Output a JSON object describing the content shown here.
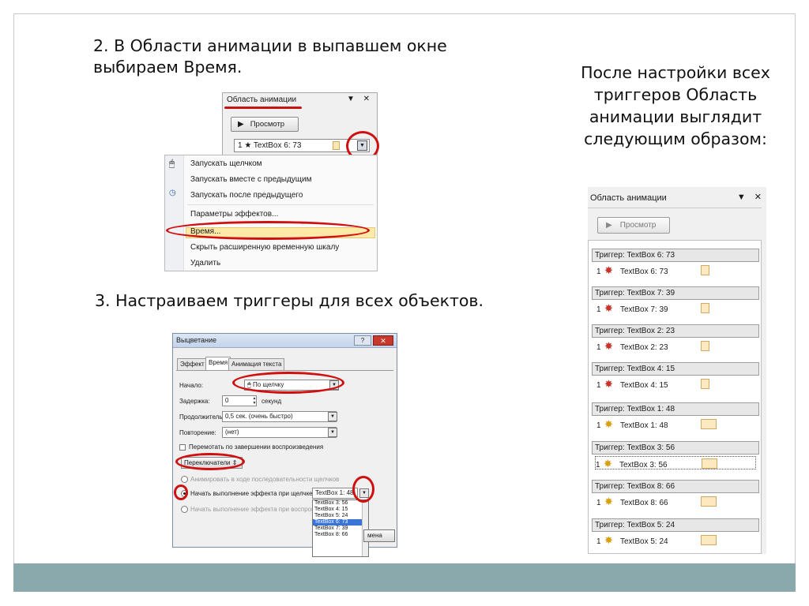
{
  "slide": {
    "step2_text": "2. В Области анимации в выпавшем окне выбираем Время.",
    "step3_text": "3. Настраиваем триггеры для всех объектов.",
    "right_text": "После настройки всех триггеров Область анимации выглядит следующим образом:"
  },
  "pane1": {
    "title": "Область анимации",
    "controls": "▼ ✕",
    "preview_label": "Просмотр",
    "row": "1 ★ TextBox 6: 73"
  },
  "context_menu": {
    "items": [
      {
        "label": "Запускать щелчком",
        "icon": "mouse-click-icon"
      },
      {
        "label": "Запускать вместе с предыдущим",
        "icon": ""
      },
      {
        "label": "Запускать после предыдущего",
        "icon": "clock-icon"
      },
      {
        "label": "Параметры эффектов...",
        "icon": ""
      },
      {
        "label": "Время...",
        "icon": ""
      },
      {
        "label": "Скрыть расширенную временную шкалу",
        "icon": ""
      },
      {
        "label": "Удалить",
        "icon": ""
      }
    ]
  },
  "dialog": {
    "title": "Выцветание",
    "help": "?",
    "close": "✕",
    "tabs": [
      "Эффект",
      "Время",
      "Анимация текста"
    ],
    "start_label": "Начало:",
    "start_value": "По щелчку",
    "delay_label": "Задержка:",
    "delay_value": "0",
    "delay_unit": "секунд",
    "duration_label": "Продолжительность:",
    "duration_value": "0,5 сек. (очень быстро)",
    "repeat_label": "Повторение:",
    "repeat_value": "(нет)",
    "rewind_label": "Перемотать по завершении воспроизведения",
    "switches_button": "Переключатели",
    "radio_animate": "Анимировать в ходе последовательности щелчков",
    "radio_start_click": "Начать выполнение эффекта при щелчке",
    "radio_start_click_value": "TextBox 1: 48",
    "radio_start_play": "Начать выполнение эффекта при воспроизв",
    "list_items": [
      "TextBox 3: 56",
      "TextBox 4: 15",
      "TextBox 5: 24",
      "TextBox 6: 73",
      "TextBox 7: 39",
      "TextBox 8: 66"
    ],
    "list_selected": "TextBox 6: 73",
    "cancel_partial": "мена"
  },
  "pane3": {
    "title": "Область анимации",
    "controls": "▼ ✕",
    "preview_label": "Просмотр",
    "triggers": [
      {
        "header": "Триггер: TextBox 6: 73",
        "item": "TextBox 6: 73",
        "num": "1",
        "effect": "red-star-icon"
      },
      {
        "header": "Триггер: TextBox 7: 39",
        "item": "TextBox 7: 39",
        "num": "1",
        "effect": "red-star-icon"
      },
      {
        "header": "Триггер: TextBox 2: 23",
        "item": "TextBox 2: 23",
        "num": "1",
        "effect": "red-star-icon"
      },
      {
        "header": "Триггер: TextBox 4: 15",
        "item": "TextBox 4: 15",
        "num": "1",
        "effect": "red-star-icon"
      },
      {
        "header": "Триггер: TextBox 1: 48",
        "item": "TextBox 1: 48",
        "num": "1",
        "effect": "yellow-star-icon"
      },
      {
        "header": "Триггер: TextBox 3: 56",
        "item": "TextBox 3: 56",
        "num": "1",
        "effect": "yellow-star-icon"
      },
      {
        "header": "Триггер: TextBox 8: 66",
        "item": "TextBox 8: 66",
        "num": "1",
        "effect": "yellow-star-icon"
      },
      {
        "header": "Триггер: TextBox 5: 24",
        "item": "TextBox 5: 24",
        "num": "1",
        "effect": "yellow-star-icon"
      }
    ]
  },
  "colors": {
    "footer_bar": "#8aa9ad",
    "highlight_circle": "#d01010",
    "menu_highlight": "#fde9a8"
  }
}
